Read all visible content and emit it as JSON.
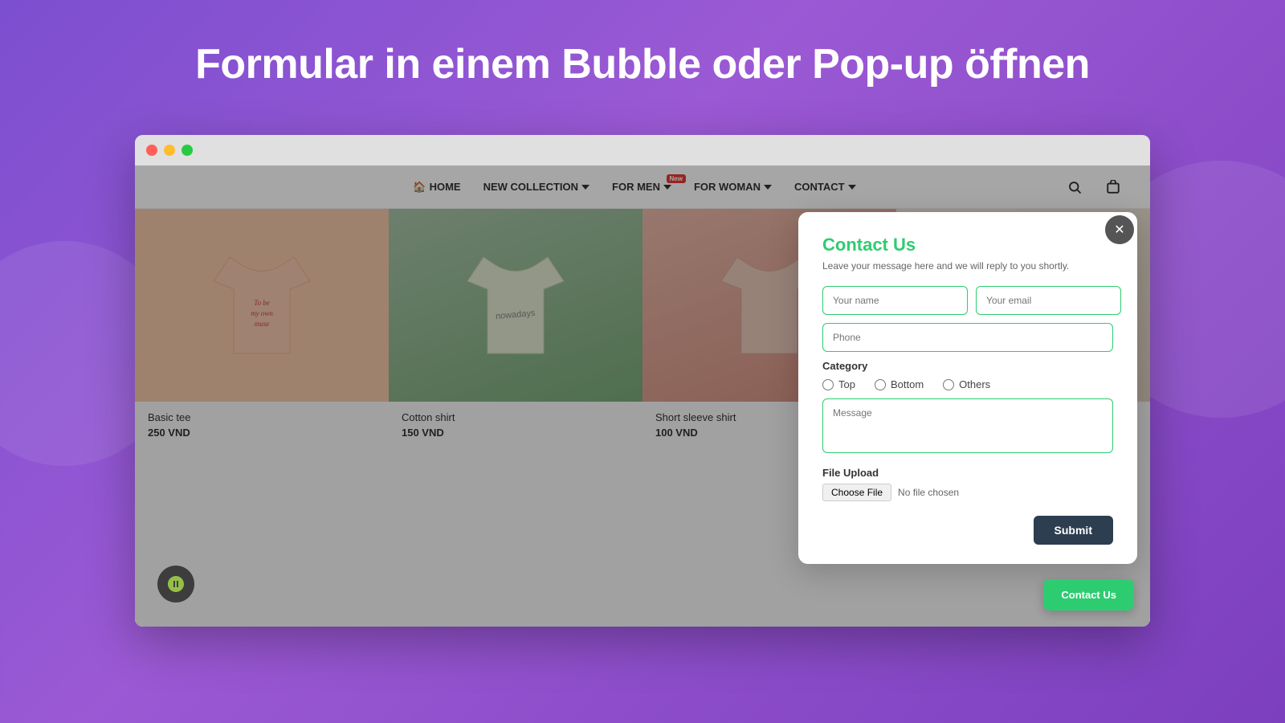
{
  "page": {
    "title": "Formular in einem Bubble oder Pop-up öffnen"
  },
  "browser": {
    "traffic_lights": [
      "red",
      "yellow",
      "green"
    ]
  },
  "navbar": {
    "home_label": "HOME",
    "nav_items": [
      {
        "id": "home",
        "label": "HOME",
        "has_dropdown": false,
        "badge": null
      },
      {
        "id": "new-collection",
        "label": "NEW COLLECTION",
        "has_dropdown": true,
        "badge": null
      },
      {
        "id": "for-men",
        "label": "FOR MEN",
        "has_dropdown": true,
        "badge": "New"
      },
      {
        "id": "for-woman",
        "label": "FOR WOMAN",
        "has_dropdown": true,
        "badge": null
      },
      {
        "id": "contact",
        "label": "CONTACT",
        "has_dropdown": true,
        "badge": null
      }
    ]
  },
  "products": [
    {
      "id": 1,
      "name": "Basic tee",
      "price": "250 VND"
    },
    {
      "id": 2,
      "name": "Cotton shirt",
      "price": "150 VND"
    },
    {
      "id": 3,
      "name": "Short sleeve shirt",
      "price": "100 VND"
    },
    {
      "id": 4,
      "name": "",
      "price": ""
    }
  ],
  "modal": {
    "title": "Contact Us",
    "subtitle": "Leave your message here and we will reply to you shortly.",
    "name_placeholder": "Your name",
    "email_placeholder": "Your email",
    "phone_placeholder": "Phone",
    "category_label": "Category",
    "categories": [
      {
        "id": "top",
        "label": "Top"
      },
      {
        "id": "bottom",
        "label": "Bottom"
      },
      {
        "id": "others",
        "label": "Others"
      }
    ],
    "message_placeholder": "Message",
    "file_upload_label": "File Upload",
    "file_choose_label": "Choose File",
    "file_no_chosen": "No file chosen",
    "submit_label": "Submit"
  },
  "contact_button": {
    "label": "Contact Us"
  },
  "colors": {
    "accent_green": "#2ecc71",
    "dark_navy": "#2c3e50",
    "purple_bg": "#7c4fd0"
  }
}
